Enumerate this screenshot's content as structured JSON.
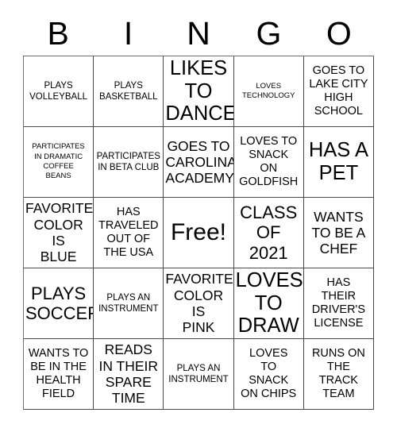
{
  "header": {
    "letters": [
      "B",
      "I",
      "N",
      "G",
      "O"
    ]
  },
  "grid": {
    "rows": [
      [
        {
          "text": "PLAYS\nVOLLEYBALL",
          "size": "sm"
        },
        {
          "text": "PLAYS\nBASKETBALL",
          "size": "sm"
        },
        {
          "text": "LIKES\nTO\nDANCE",
          "size": "xxl"
        },
        {
          "text": "LOVES\nTECHNOLOGY",
          "size": "xs"
        },
        {
          "text": "GOES TO\nLAKE CITY\nHIGH\nSCHOOL",
          "size": "md"
        }
      ],
      [
        {
          "text": "PARTICIPATES\nIN DRAMATIC\nCOFFEE\nBEANS",
          "size": "xs"
        },
        {
          "text": "PARTICIPATES\nIN BETA CLUB",
          "size": "sm"
        },
        {
          "text": "GOES TO\nCAROLINA\nACADEMY",
          "size": "lg"
        },
        {
          "text": "LOVES TO\nSNACK\nON\nGOLDFISH",
          "size": "md"
        },
        {
          "text": "HAS A\nPET",
          "size": "xxl"
        }
      ],
      [
        {
          "text": "FAVORITE\nCOLOR IS\nBLUE",
          "size": "lg"
        },
        {
          "text": "HAS\nTRAVELED\nOUT OF\nTHE USA",
          "size": "md"
        },
        {
          "text": "Free!",
          "size": "free"
        },
        {
          "text": "CLASS\nOF\n2021",
          "size": "xl"
        },
        {
          "text": "WANTS\nTO BE A\nCHEF",
          "size": "lg"
        }
      ],
      [
        {
          "text": "PLAYS\nSOCCER",
          "size": "xl"
        },
        {
          "text": "PLAYS AN\nINSTRUMENT",
          "size": "sm"
        },
        {
          "text": "FAVORITE\nCOLOR IS\nPINK",
          "size": "lg"
        },
        {
          "text": "LOVES\nTO\nDRAW",
          "size": "xxl"
        },
        {
          "text": "HAS\nTHEIR\nDRIVER'S\nLICENSE",
          "size": "md"
        }
      ],
      [
        {
          "text": "WANTS TO\nBE IN THE\nHEALTH\nFIELD",
          "size": "md"
        },
        {
          "text": "READS\nIN THEIR\nSPARE\nTIME",
          "size": "lg"
        },
        {
          "text": "PLAYS AN\nINSTRUMENT",
          "size": "sm"
        },
        {
          "text": "LOVES\nTO\nSNACK\nON CHIPS",
          "size": "md"
        },
        {
          "text": "RUNS ON\nTHE\nTRACK\nTEAM",
          "size": "md"
        }
      ]
    ]
  },
  "colors": {
    "text": "#000000",
    "background": "#ffffff",
    "grid_line": "#4a4a4a"
  }
}
